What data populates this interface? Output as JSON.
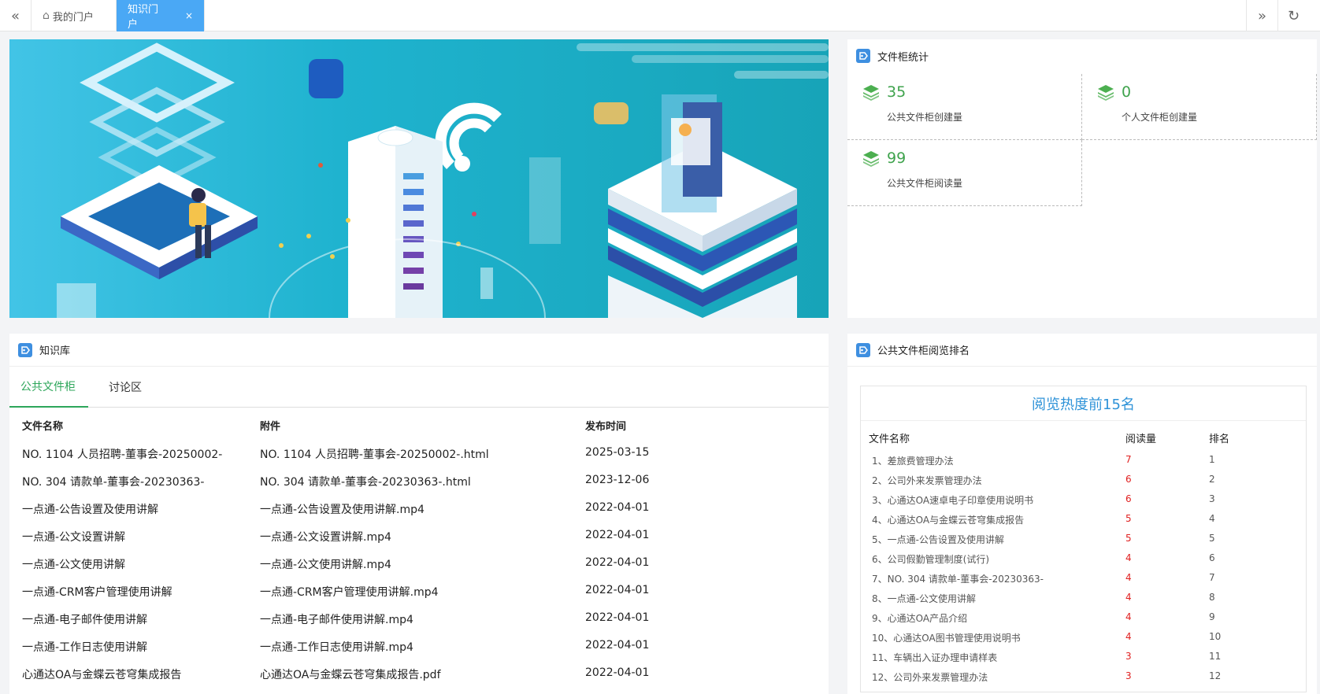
{
  "topbar": {
    "tabs": [
      {
        "label": "我的门户"
      },
      {
        "label": "知识门户",
        "close": "×"
      }
    ]
  },
  "stats": {
    "title": "文件柜统计",
    "items": [
      {
        "value": "35",
        "label": "公共文件柜创建量"
      },
      {
        "value": "0",
        "label": "个人文件柜创建量"
      },
      {
        "value": "99",
        "label": "公共文件柜阅读量"
      }
    ]
  },
  "knowledge": {
    "title": "知识库",
    "tabs": [
      "公共文件柜",
      "讨论区"
    ],
    "columns": [
      "文件名称",
      "附件",
      "发布时间"
    ],
    "rows": [
      {
        "name": "NO. 1104 人员招聘-董事会-20250002-",
        "file": "NO. 1104 人员招聘-董事会-20250002-.html",
        "date": "2025-03-15"
      },
      {
        "name": "NO. 304 请款单-董事会-20230363-",
        "file": "NO. 304 请款单-董事会-20230363-.html",
        "date": "2023-12-06"
      },
      {
        "name": "一点通-公告设置及使用讲解",
        "file": "一点通-公告设置及使用讲解.mp4",
        "date": "2022-04-01"
      },
      {
        "name": "一点通-公文设置讲解",
        "file": "一点通-公文设置讲解.mp4",
        "date": "2022-04-01"
      },
      {
        "name": "一点通-公文使用讲解",
        "file": "一点通-公文使用讲解.mp4",
        "date": "2022-04-01"
      },
      {
        "name": "一点通-CRM客户管理使用讲解",
        "file": "一点通-CRM客户管理使用讲解.mp4",
        "date": "2022-04-01"
      },
      {
        "name": "一点通-电子邮件使用讲解",
        "file": "一点通-电子邮件使用讲解.mp4",
        "date": "2022-04-01"
      },
      {
        "name": "一点通-工作日志使用讲解",
        "file": "一点通-工作日志使用讲解.mp4",
        "date": "2022-04-01"
      },
      {
        "name": "心通达OA与金蝶云苍穹集成报告",
        "file": "心通达OA与金蝶云苍穹集成报告.pdf",
        "date": "2022-04-01"
      }
    ]
  },
  "ranking": {
    "title": "公共文件柜阅览排名",
    "box_title": "阅览热度前15名",
    "columns": [
      "文件名称",
      "阅读量",
      "排名"
    ],
    "rows": [
      {
        "name": "1、差旅费管理办法",
        "views": "7",
        "rank": "1"
      },
      {
        "name": "2、公司外来发票管理办法",
        "views": "6",
        "rank": "2"
      },
      {
        "name": "3、心通达OA速卓电子印章使用说明书",
        "views": "6",
        "rank": "3"
      },
      {
        "name": "4、心通达OA与金蝶云苍穹集成报告",
        "views": "5",
        "rank": "4"
      },
      {
        "name": "5、一点通-公告设置及使用讲解",
        "views": "5",
        "rank": "5"
      },
      {
        "name": "6、公司假勤管理制度(试行)",
        "views": "4",
        "rank": "6"
      },
      {
        "name": "7、NO. 304 请款单-董事会-20230363-",
        "views": "4",
        "rank": "7"
      },
      {
        "name": "8、一点通-公文使用讲解",
        "views": "4",
        "rank": "8"
      },
      {
        "name": "9、心通达OA产品介绍",
        "views": "4",
        "rank": "9"
      },
      {
        "name": "10、心通达OA图书管理使用说明书",
        "views": "4",
        "rank": "10"
      },
      {
        "name": "11、车辆出入证办理申请样表",
        "views": "3",
        "rank": "11"
      },
      {
        "name": "12、公司外来发票管理办法",
        "views": "3",
        "rank": "12"
      }
    ]
  },
  "colors": {
    "accent": "#4aa8f5",
    "green": "#2da65a",
    "red": "#e02020",
    "rank_title": "#2f93d8"
  }
}
